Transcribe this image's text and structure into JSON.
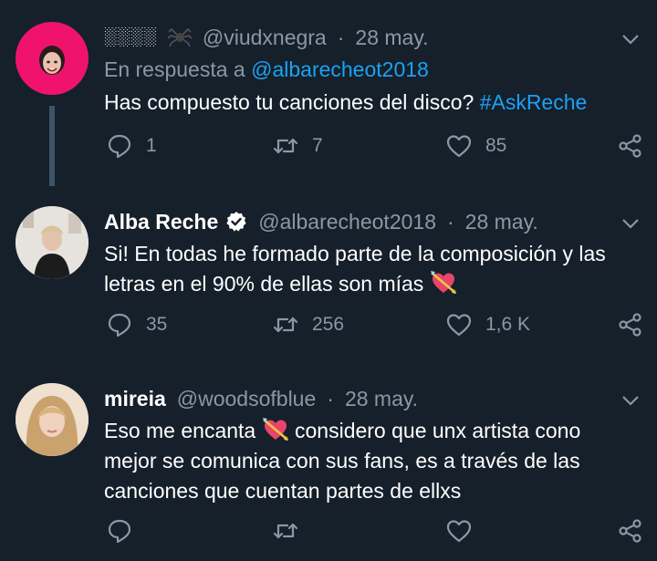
{
  "tweets": [
    {
      "name": "░░░░",
      "handle": "@viudxnegra",
      "date": "28 may.",
      "reply_prefix": "En respuesta a",
      "reply_handle": "@albarecheot2018",
      "text": "Has compuesto tu canciones del disco?",
      "hashtag": "#AskReche",
      "replies": "1",
      "retweets": "7",
      "likes": "85"
    },
    {
      "name": "Alba Reche",
      "handle": "@albarecheot2018",
      "date": "28 may.",
      "text_line1": "Si! En todas he formado parte de la composición y las",
      "text_line2": "letras en el 90% de ellas son mías",
      "replies": "35",
      "retweets": "256",
      "likes": "1,6 K"
    },
    {
      "name": "mireia",
      "handle": "@woodsofblue",
      "date": "28 may.",
      "text_line1_a": "Eso me encanta",
      "text_line1_b": "considero que unx artista cono",
      "text_line2": "mejor se comunica con sus fans, es a través de las",
      "text_line3": "canciones que cuentan partes de ellxs"
    }
  ],
  "separator": "·",
  "colors": {
    "background": "#15202b",
    "muted": "#8899a6",
    "link": "#1da1f2",
    "avatar_pink": "#f0136e"
  },
  "icons": [
    "spider-icon",
    "verified-badge-icon",
    "heart-arrow-emoji-icon",
    "reply-icon",
    "retweet-icon",
    "like-icon",
    "share-icon",
    "chevron-down-icon"
  ]
}
